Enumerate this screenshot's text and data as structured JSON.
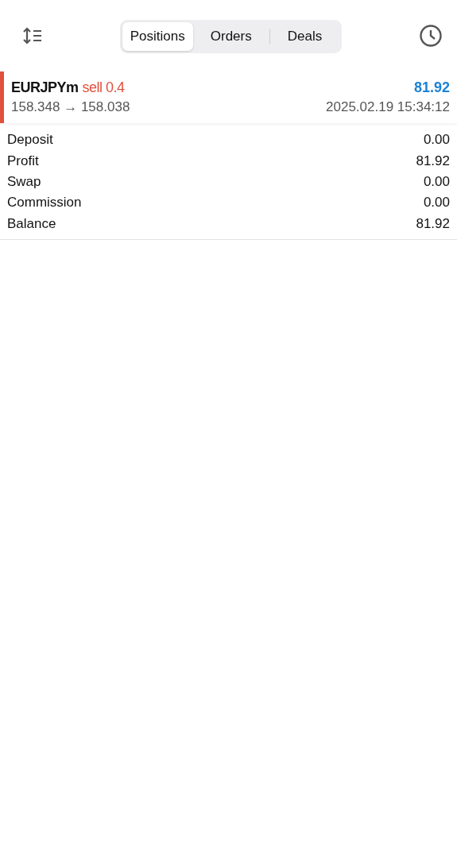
{
  "tabs": [
    {
      "label": "Positions",
      "selected": true
    },
    {
      "label": "Orders",
      "selected": false
    },
    {
      "label": "Deals",
      "selected": false
    }
  ],
  "positions": [
    {
      "symbol": "EURJPYm",
      "order": "sell 0.4",
      "color": "#e0503c",
      "profit": "81.92",
      "prices": "158.348 → 158.038",
      "time": "2025.02.19 15:34:12"
    }
  ],
  "summary": [
    {
      "label": "Deposit",
      "value": "0.00"
    },
    {
      "label": "Profit",
      "value": "81.92"
    },
    {
      "label": "Swap",
      "value": "0.00"
    },
    {
      "label": "Commission",
      "value": "0.00"
    },
    {
      "label": "Balance",
      "value": "81.92"
    }
  ]
}
